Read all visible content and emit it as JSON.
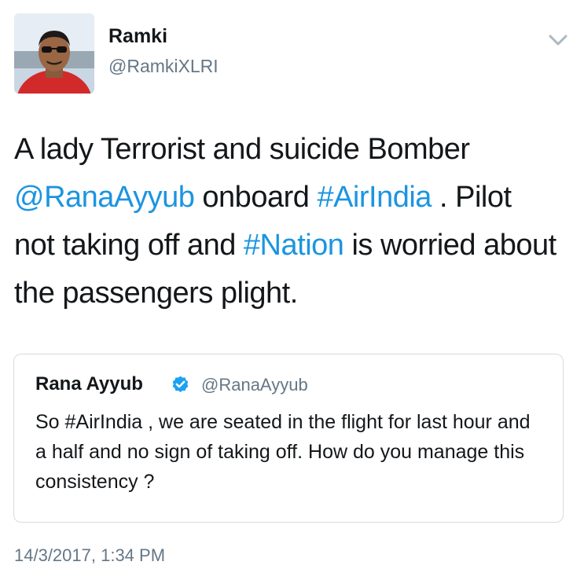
{
  "author": {
    "display_name": "Ramki",
    "handle": "@RamkiXLRI"
  },
  "menu": {
    "icon": "chevron-down-icon"
  },
  "tweet": {
    "segments": [
      {
        "text": "A lady Terrorist and suicide Bomber ",
        "link": false
      },
      {
        "text": "@RanaAyyub",
        "link": true
      },
      {
        "text": " onboard ",
        "link": false
      },
      {
        "text": "#AirIndia",
        "link": true
      },
      {
        "text": " . Pilot not taking off and ",
        "link": false
      },
      {
        "text": "#Nation",
        "link": true
      },
      {
        "text": " is worried about the passengers plight.",
        "link": false
      }
    ]
  },
  "quoted_tweet": {
    "display_name": "Rana Ayyub",
    "handle": "@RanaAyyub",
    "verified_icon": "verified-badge-icon",
    "text": "So #AirIndia , we are seated in the flight for last hour and a half and no sign of taking off. How do you manage this consistency ?"
  },
  "timestamp": "14/3/2017, 1:34 PM",
  "colors": {
    "link": "#1b95e0",
    "text": "#14171a",
    "secondary": "#657786",
    "verified": "#1da1f2",
    "card_border": "#d5dbe0"
  }
}
